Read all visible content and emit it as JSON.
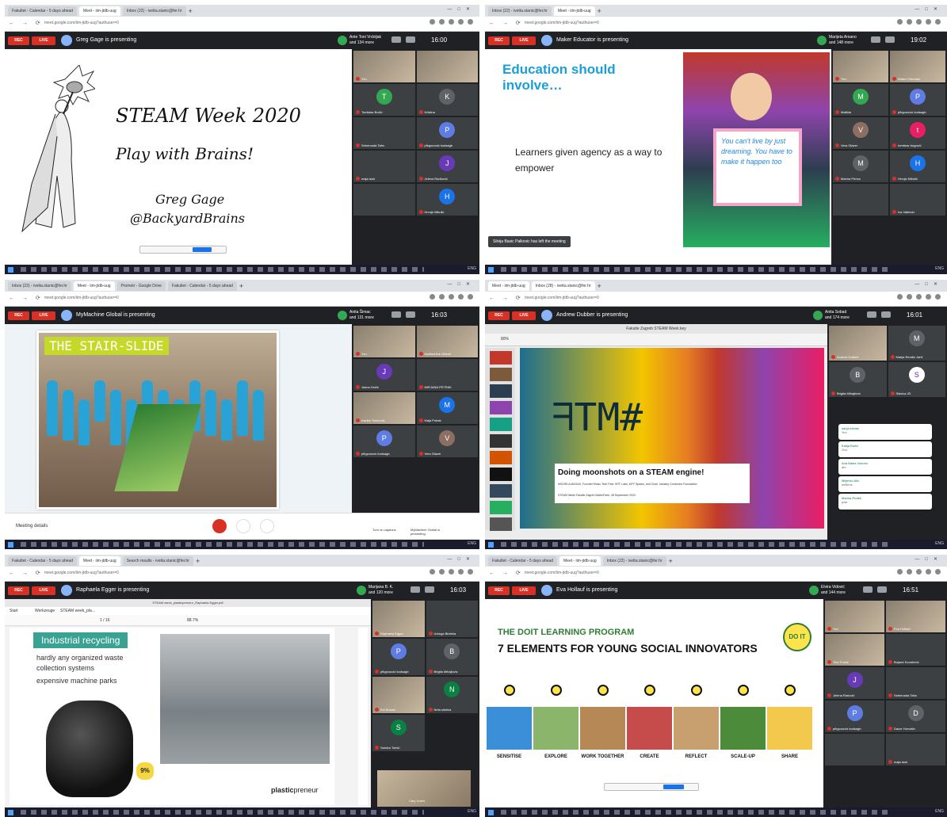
{
  "s1": {
    "tabs": [
      "Fakultet - Calendar - 5 days ahead",
      "Meet - iim-jtdb-uug",
      "Inbox (22) - ivetta.stanic@fer.hr"
    ],
    "url": "meet.google.com/iim-jtdb-uug?authuser=0",
    "rec": "REC",
    "live": "LIVE",
    "presenting": "Greg Gage is presenting",
    "joined": "Ante Toni Vrdoljak\nand 134 more",
    "clock": "16:00",
    "slide": {
      "title": "STEAM Week 2020",
      "subtitle": "Play with Brains!",
      "author": "Greg Gage",
      "handle": "@BackyardBrains"
    },
    "tiles": [
      {
        "n": "You",
        "a": "",
        "c": "",
        "p": true
      },
      {
        "n": "",
        "a": "",
        "c": "",
        "p": true
      },
      {
        "n": "Tomislav Božić",
        "a": "T",
        "c": "#33a852"
      },
      {
        "n": "Kristina",
        "a": "K",
        "c": "#5f6368"
      },
      {
        "n": "Sebercada Tabo",
        "a": "",
        "c": ""
      },
      {
        "n": "pfkgoooolz kodsagb",
        "a": "P",
        "c": "#5e7ce2"
      },
      {
        "n": "maja lauš",
        "a": "",
        "c": ""
      },
      {
        "n": "Jelena Radković",
        "a": "J",
        "c": "#673ab7"
      },
      {
        "n": "",
        "a": "",
        "c": ""
      },
      {
        "n": "Hrvoje Mikulić",
        "a": "H",
        "c": "#1a73e8"
      }
    ]
  },
  "s2": {
    "tabs": [
      "Inbox (22) - ivetta.stanic@fer.hr",
      "Meet - iim-jtdb-uug"
    ],
    "url": "meet.google.com/iim-jtdb-uug?authuser=0",
    "rec": "REC",
    "live": "LIVE",
    "presenting": "Maker Educator is presenting",
    "joined": "Marijeta Amano\nand 148 more",
    "clock": "19:02",
    "slide": {
      "title": "Education should involve…",
      "body": "Learners given agency as a way to empower",
      "card": "You can't live by just dreaming. You have to make it happen too"
    },
    "toast": "Silvija Basic Palkovic has left the meeting",
    "tiles": [
      {
        "n": "You",
        "a": "",
        "c": "",
        "p": true
      },
      {
        "n": "Maker Educator",
        "a": "",
        "c": "",
        "p": true
      },
      {
        "n": "Matilda",
        "a": "M",
        "c": "#33a852"
      },
      {
        "n": "pfkgoooolz kodsagb",
        "a": "P",
        "c": "#5e7ce2"
      },
      {
        "n": "Vera Glazer",
        "a": "V",
        "c": "#8d6e63"
      },
      {
        "n": "tomislav bogović",
        "a": "t",
        "c": "#e91e63"
      },
      {
        "n": "Marina Perica",
        "a": "M",
        "c": "#5f6368"
      },
      {
        "n": "Hrvoje Mikulić",
        "a": "H",
        "c": "#1a73e8"
      },
      {
        "n": "",
        "a": "",
        "c": ""
      },
      {
        "n": "Iva Valencic",
        "a": "",
        "c": ""
      }
    ]
  },
  "s3": {
    "tabs": [
      "Inbox (22) - ivetta.stanic@fer.hr",
      "Meet - iim-jtdb-uug",
      "Prometr - Google Drive",
      "Fakultet - Calendar - 5 days ahead"
    ],
    "url": "meet.google.com/iim-jtdb-uug?authuser=0",
    "rec": "REC",
    "live": "LIVE",
    "presenting": "MyMachine Global is presenting",
    "joined": "Anita Šimac\nand 131 more",
    "clock": "16:03",
    "slide": {
      "title": "THE STAIR-SLIDE"
    },
    "controls": {
      "details": "Meeting details",
      "captions": "Turn on captions",
      "presentingNote": "MyMachine Global is presenting"
    },
    "tiles": [
      {
        "n": "You",
        "a": "",
        "c": "",
        "p": true
      },
      {
        "n": "MyMachine Global",
        "a": "",
        "c": "",
        "p": true
      },
      {
        "n": "Jasna Hrolić",
        "a": "J",
        "c": "#673ab7"
      },
      {
        "n": "MIRJANA PETRAK",
        "a": "",
        "c": ""
      },
      {
        "n": "Ivanka Tomković",
        "a": "",
        "c": "",
        "p": true
      },
      {
        "n": "Maja Pubak",
        "a": "M",
        "c": "#1a73e8"
      },
      {
        "n": "pfkgoooolz kodsagb",
        "a": "P",
        "c": "#5e7ce2"
      },
      {
        "n": "Vera Glazer",
        "a": "V",
        "c": "#8d6e63"
      }
    ]
  },
  "s4": {
    "tabs": [
      "Meet - iim-jtdb-uug",
      "Inbox (28) - ivetta.stanic@fer.hr"
    ],
    "url": "meet.google.com/iim-jtdb-uug?authuser=0",
    "rec": "REC",
    "live": "LIVE",
    "presenting": "Andrew Dubber is presenting",
    "joined": "Anita Sobad\nand 174 more",
    "clock": "16:01",
    "slide": {
      "keynoteTitle": "Fakulte Zagreb STEAM Week.key",
      "zoom": "80%",
      "title": "Doing moonshots on a STEAM engine!",
      "credit": "MICHELA MAGAS, Founder Music Tech Fest, MTF Labs, MTF Sparks, and Chair, Industry Commons Foundation",
      "event": "STEAM Week Fakulte Zagreb MakerFaire, 28 September 2020"
    },
    "tiles": [
      {
        "n": "Andrew Dubber",
        "a": "",
        "c": "",
        "p": true
      },
      {
        "n": "Marija Rendić Jarič",
        "a": "M",
        "c": "#5f6368"
      },
      {
        "n": "Brigita Mihajlovic",
        "a": "B",
        "c": "#5f6368"
      },
      {
        "n": "Slavica JD",
        "a": "S",
        "c": "#fff"
      }
    ],
    "notifs": [
      {
        "n": "sanja klenac",
        "s": "You"
      },
      {
        "n": "Katija Burlić",
        "s": "Ovo"
      },
      {
        "n": "Ana Balea Vukovic",
        "s": "ato"
      },
      {
        "n": "Miljenko Alić",
        "s": "eeBrius"
      },
      {
        "n": "Marina Rodek",
        "s": "pwe"
      }
    ]
  },
  "s5": {
    "tabs": [
      "Fakultet - Calendar - 5 days ahead",
      "Meet - iim-jtdb-uug",
      "Search results - ivetta.stanic@fer.hr"
    ],
    "url": "meet.google.com/iim-jtdb-uug?authuser=0",
    "rec": "REC",
    "live": "LIVE",
    "presenting": "Raphaela Egger is presenting",
    "joined": "Marijana B. K.\nand 120 more",
    "clock": "16:03",
    "pdf": {
      "filename": "STEAM week_plasticpreneur_Raphaela Egger.pdf",
      "tabs": [
        "Start",
        "Werkzeuge",
        "STEAM week_pla…"
      ],
      "zoom": "88.7%",
      "page": "1 / 16"
    },
    "slide": {
      "title": "Industrial recycling",
      "line1": "hardly any organized waste collection systems",
      "line2": "expensive machine parks",
      "badge": "9%",
      "brandA": "plastic",
      "brandB": "preneur"
    },
    "tiles": [
      {
        "n": "Raphaela Egger",
        "a": "",
        "c": "",
        "p": true
      },
      {
        "n": "Udruga Bioteka",
        "a": "",
        "c": ""
      },
      {
        "n": "pfkgoooolz kodsagb",
        "a": "P",
        "c": "#5e7ce2"
      },
      {
        "n": "Brigita Mihajlovic",
        "a": "B",
        "c": "#5f6368"
      },
      {
        "n": "Edi Bučani",
        "a": "",
        "c": "",
        "p": true
      },
      {
        "n": "Neta sikirica",
        "a": "N",
        "c": "#0b8043"
      },
      {
        "n": "Sandra Tomić",
        "a": "S",
        "c": "#0b8043"
      }
    ],
    "pip": "Cary Jones"
  },
  "s6": {
    "tabs": [
      "Fakultet - Calendar - 5 days ahead",
      "Meet - iim-jtdb-uug",
      "Inbox (22) - ivetta.stanic@fer.hr"
    ],
    "url": "meet.google.com/iim-jtdb-uug?authuser=0",
    "rec": "REC",
    "live": "LIVE",
    "presenting": "Eva Hollauf is presenting",
    "joined": "Elvira Vidović\nand 144 more",
    "clock": "16:51",
    "slide": {
      "kicker": "THE DOIT LEARNING PROGRAM",
      "title": "7 ELEMENTS FOR YOUNG SOCIAL INNOVATORS",
      "logo": "DO IT",
      "steps": [
        "SENSITISE",
        "EXPLORE",
        "WORK TOGETHER",
        "CREATE",
        "REFLECT",
        "SCALE-UP",
        "SHARE"
      ]
    },
    "tiles": [
      {
        "n": "You",
        "a": "",
        "c": "",
        "p": true
      },
      {
        "n": "Eva Hollauf",
        "a": "",
        "c": "",
        "p": true
      },
      {
        "n": "Tina Franić",
        "a": "",
        "c": "",
        "p": true
      },
      {
        "n": "Bojana Kovačević",
        "a": "",
        "c": ""
      },
      {
        "n": "Jelena Radović",
        "a": "J",
        "c": "#673ab7"
      },
      {
        "n": "Sebercada Tabo",
        "a": "",
        "c": ""
      },
      {
        "n": "pfkgoooolz kodsagb",
        "a": "P",
        "c": "#5e7ce2"
      },
      {
        "n": "Davor Horvatin",
        "a": "D",
        "c": "#5f6368"
      },
      {
        "n": "",
        "a": "",
        "c": ""
      },
      {
        "n": "maja lauš",
        "a": "",
        "c": ""
      }
    ]
  }
}
